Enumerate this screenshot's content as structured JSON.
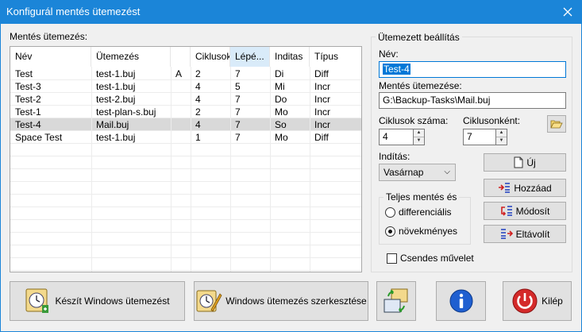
{
  "window": {
    "title": "Konfigurál mentés ütemezést"
  },
  "list": {
    "label": "Mentés ütemezés:",
    "columns": [
      "Név",
      "Ütemezés",
      "",
      "Ciklusok",
      "Lépé...",
      "Inditas",
      "Típus"
    ],
    "rows": [
      [
        "Test",
        "test-1.buj",
        "A",
        "2",
        "7",
        "Di",
        "Diff"
      ],
      [
        "Test-3",
        "test-1.buj",
        "",
        "4",
        "5",
        "Mi",
        "Incr"
      ],
      [
        "Test-2",
        "test-2.buj",
        "",
        "4",
        "7",
        "Do",
        "Incr"
      ],
      [
        "Test-1",
        "test-plan-s.buj",
        "",
        "2",
        "7",
        "Mo",
        "Incr"
      ],
      [
        "Test-4",
        "Mail.buj",
        "",
        "4",
        "7",
        "So",
        "Incr"
      ],
      [
        "Space Test",
        "test-1.buj",
        "",
        "1",
        "7",
        "Mo",
        "Diff"
      ]
    ],
    "selected_row": 4
  },
  "settings": {
    "group_title": "Ütemezett beállítás",
    "name_label": "Név:",
    "name_value": "Test-4",
    "schedule_label": "Mentés ütemezése:",
    "schedule_value": "G:\\Backup-Tasks\\Mail.buj",
    "cycles_label": "Ciklusok száma:",
    "cycles_value": "4",
    "per_cycle_label": "Ciklusonként:",
    "per_cycle_value": "7",
    "start_label": "Indítás:",
    "start_value": "Vasárnap",
    "full_backup_title": "Teljes mentés és",
    "radio_diff": "differenciális",
    "radio_incr": "növekményes",
    "silent_label": "Csendes művelet",
    "btn_new": "Új",
    "btn_add": "Hozzáad",
    "btn_modify": "Módosít",
    "btn_remove": "Eltávolít"
  },
  "bottom": {
    "create_windows_schedule": "Készít Windows ütemezést",
    "edit_windows_schedule": "Windows ütemezés szerkesztése",
    "exit": "Kilép"
  }
}
